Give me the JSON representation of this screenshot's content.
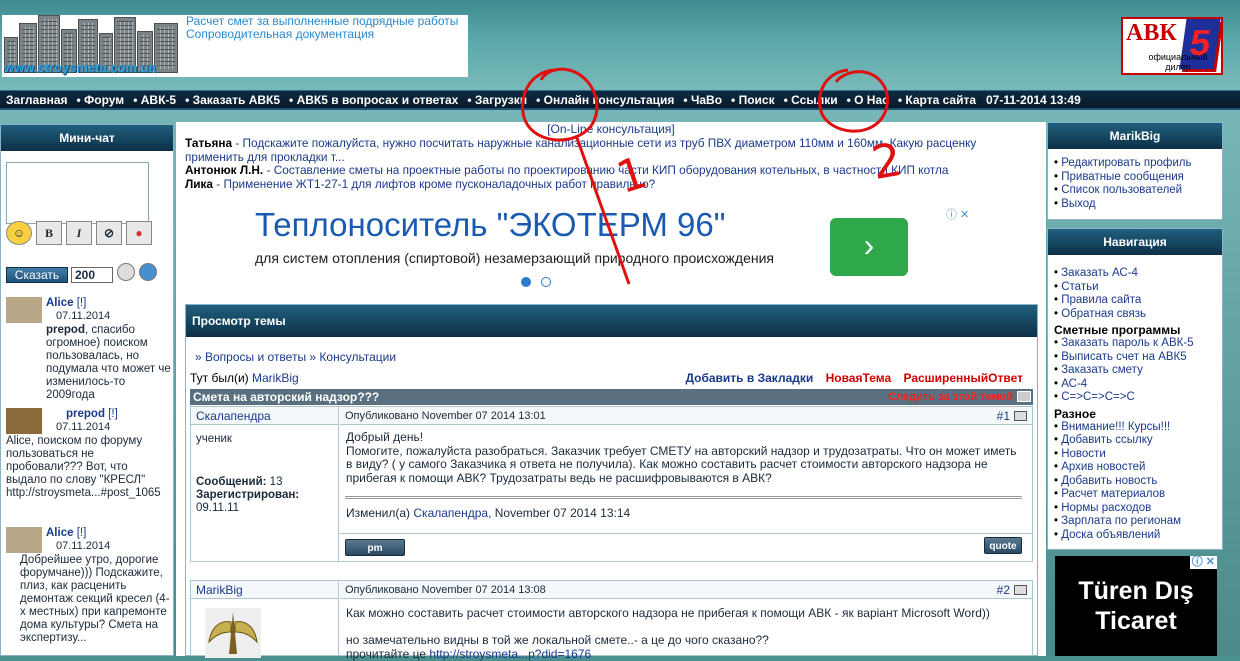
{
  "header": {
    "logo_text": "www.stroysmeta.com.ua",
    "logo_links": [
      "Расчет смет за выполненные подрядные работы",
      "Сопроводительная документация"
    ],
    "brand": "АВК",
    "brand_num": "5",
    "brand_sub": "официальный дилер"
  },
  "nav": {
    "items": [
      "Заглавная",
      "Форум",
      "АВК-5",
      "Заказать АВК5",
      "АВК5 в вопросах и ответах",
      "Загрузки",
      "Онлайн консультация",
      "ЧаВо",
      "Поиск",
      "Ссылки",
      "О Нас",
      "Карта сайта"
    ],
    "date": "07-11-2014 13:49"
  },
  "chat": {
    "title": "Мини-чат",
    "bold_btn": "B",
    "italic_btn": "I",
    "say_btn": "Сказать",
    "count": "200",
    "messages": [
      {
        "name": "Alice",
        "tag": "[!]",
        "date": "07.11.2014",
        "text_bold": "prepod",
        "text": ", спасибо огромное) поиском пользовалась, но подумала что может че изменилось-то 2009года"
      },
      {
        "name": "prepod",
        "tag": "[!]",
        "date": "07.11.2014",
        "text_bold": "",
        "text": "Alice, поиском по форуму пользоваться не пробовали??? Вот, что выдало по слову \"КРЕСЛ\" http://stroysmeta...#post_1065"
      },
      {
        "name": "Alice",
        "tag": "[!]",
        "date": "07.11.2014",
        "text_bold": "",
        "text": "Добрейшее утро, дорогие форумчане))) Подскажите, плиз, как расценить демонтаж секций кресел (4-х местных) при капремонте дома культуры? Смета на экспертизу..."
      }
    ]
  },
  "center": {
    "online": "[On-Line консультация]",
    "news": [
      {
        "name": "Татьяна",
        "text": " - Подскажите пожалуйста, нужно посчитать наружные канализационные сети из труб ПВХ диаметром 110мм и 160мм. Какую расценку",
        "text2": "применить для прокладки т..."
      },
      {
        "name": "Антонюк Л.Н.",
        "text": " - Составление сметы на проектные работы по проектированию части КИП оборудования котельных, в частности КИП котла",
        "text2": ""
      },
      {
        "name": "Лика",
        "text": " - Применение ЖТ1-27-1 для лифтов кроме пусконаладочных работ правильно?",
        "text2": ""
      }
    ],
    "ad": {
      "headline": "Теплоноситель \"ЭКОТЕРМ 96\"",
      "sub": "для систем отопления (спиртовой) незамерзающий природного происхождения",
      "info": "ⓘ ✕",
      "arrow": "›"
    },
    "topic": {
      "title": "Просмотр темы",
      "crumb": "» Вопросы и ответы » Консультации",
      "visited_label": "Тут был(и) ",
      "visited_user": "MarikBig",
      "actions": [
        "Добавить в Закладки",
        "НоваяТема",
        "РасширенныйОтвет"
      ],
      "subject": "Смета на авторский надзор???",
      "follow": "Следить за этой темой",
      "posts": [
        {
          "author": "Скалапендра",
          "posted": "Опубликовано November 07 2014 13:01",
          "num": "#1",
          "rank": "ученик",
          "msgs_label": "Сообщений:",
          "msgs": " 13",
          "reg_label": "Зарегистрирован:",
          "reg": "09.11.11",
          "body": [
            "Добрый день!",
            "Помогите, пожалуйста разобраться. Заказчик требует СМЕТУ на авторский надзор и трудозатраты. Что он может иметь в виду? ( у самого Заказчика я ответа не получила). Как можно составить расчет стоимости авторского надзора не прибегая к помощи АВК? Трудозатраты ведь не расшифровываются в АВК?"
          ],
          "edited_label": "Изменил(а) ",
          "edited_user": "Скалапендра",
          "edited_date": ", November 07 2014 13:14",
          "pm": "pm",
          "quote": "quote"
        },
        {
          "author": "MarikBig",
          "posted": "Опубликовано November 07 2014 13:08",
          "num": "#2",
          "body": [
            "Как можно составить расчет стоимости авторского надзора не прибегая к помощи АВК - як варіант Microsoft Word))",
            "",
            "но замечательно видны в той же локальной смете..- а це до чого сказано??"
          ],
          "link_label": "прочитайте це ",
          "link": "http://stroysmeta...p?did=1676"
        }
      ]
    }
  },
  "marik": {
    "title": "MarikBig",
    "items": [
      "Редактировать профиль",
      "Приватные сообщения",
      "Список пользователей",
      "Выход"
    ]
  },
  "navig": {
    "title": "Навигация",
    "items": [
      "Заказать АС-4",
      "Статьи",
      "Правила сайта",
      "Обратная связь"
    ],
    "h2": "Сметные программы",
    "items2": [
      "Заказать пароль к АВК-5",
      "Выписать счет на АВК5",
      "Заказать смету",
      "АС-4",
      "С=>С=>С=>С"
    ],
    "h3": "Разное",
    "items3": [
      "Внимание!!! Курсы!!!",
      "Добавить ссылку",
      "Новости",
      "Архив новостей",
      "Добавить новость",
      "Расчет материалов",
      "Нормы расходов",
      "Зарплата по регионам",
      "Доска объявлений"
    ]
  },
  "ad2": {
    "line1": "Türen Dış",
    "line2": "Ticaret",
    "info": "ⓘ ✕"
  },
  "annotations": {
    "n1": "1",
    "n2": "2",
    "color": "#e01010"
  }
}
